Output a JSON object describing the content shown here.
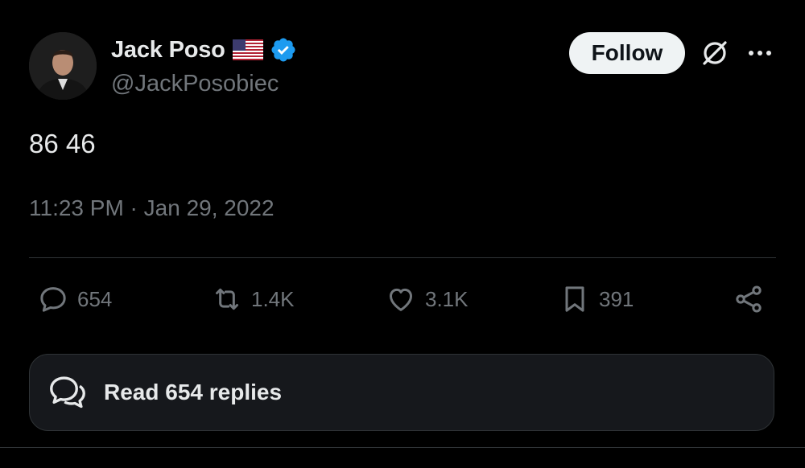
{
  "author": {
    "name": "Jack Poso",
    "handle": "@JackPosobiec",
    "flag_icon": "us-flag-icon",
    "verified_icon": "verified-badge-icon",
    "verified_color": "#1d9bf0"
  },
  "header_actions": {
    "follow_label": "Follow",
    "grok_icon": "grok-icon",
    "more_icon": "more-icon"
  },
  "tweet": {
    "text": "86 46",
    "timestamp": "11:23 PM · Jan 29, 2022"
  },
  "engagement": {
    "replies": "654",
    "retweets": "1.4K",
    "likes": "3.1K",
    "bookmarks": "391"
  },
  "read_replies": {
    "label": "Read 654 replies"
  },
  "colors": {
    "background": "#000000",
    "text_primary": "#e7e9ea",
    "text_secondary": "#71767b",
    "divider": "#2f3336",
    "follow_bg": "#eff3f4"
  }
}
